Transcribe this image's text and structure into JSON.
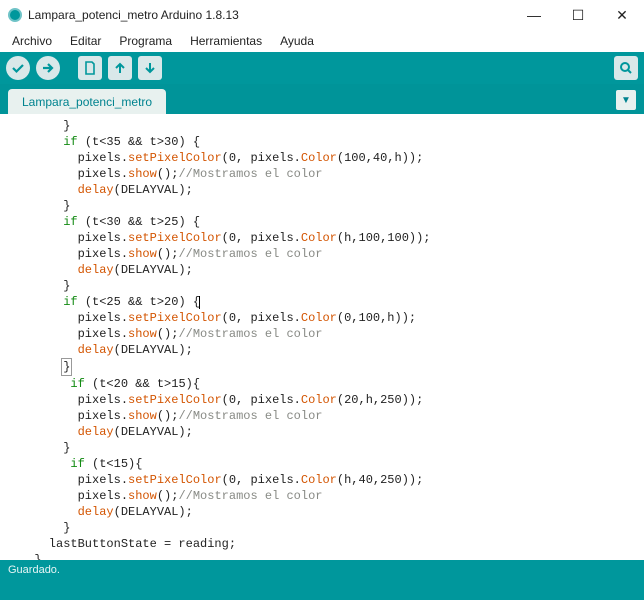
{
  "window": {
    "title": "Lampara_potenci_metro Arduino 1.8.13",
    "min_icon": "—",
    "max_icon": "☐",
    "close_icon": "✕"
  },
  "menu": {
    "archivo": "Archivo",
    "editar": "Editar",
    "programa": "Programa",
    "herramientas": "Herramientas",
    "ayuda": "Ayuda"
  },
  "toolbar_icons": {
    "verify": "verify-icon",
    "upload": "upload-icon",
    "new": "new-icon",
    "open": "open-icon",
    "save": "save-icon",
    "serial": "serial-monitor-icon"
  },
  "tabs": {
    "main": "Lampara_potenci_metro",
    "menu_glyph": "▼"
  },
  "code": {
    "l1": "      }",
    "l2a": "      ",
    "l2b": "if",
    "l2c": " (t<35 && t>30) {",
    "l3a": "        pixels.",
    "l3b": "setPixelColor",
    "l3c": "(0, pixels.",
    "l3d": "Color",
    "l3e": "(100,40,h));",
    "l4a": "        pixels.",
    "l4b": "show",
    "l4c": "();",
    "l4d": "//Mostramos el color",
    "l5a": "        ",
    "l5b": "delay",
    "l5c": "(DELAYVAL);",
    "l6": "      }",
    "l7a": "      ",
    "l7b": "if",
    "l7c": " (t<30 && t>25) {",
    "l8a": "        pixels.",
    "l8b": "setPixelColor",
    "l8c": "(0, pixels.",
    "l8d": "Color",
    "l8e": "(h,100,100));",
    "l9a": "        pixels.",
    "l9b": "show",
    "l9c": "();",
    "l9d": "//Mostramos el color",
    "l10a": "        ",
    "l10b": "delay",
    "l10c": "(DELAYVAL);",
    "l11": "      }",
    "l12a": "      ",
    "l12b": "if",
    "l12c": " (t<25 && t>20) {",
    "l13a": "        pixels.",
    "l13b": "setPixelColor",
    "l13c": "(0, pixels.",
    "l13d": "Color",
    "l13e": "(0,100,h));",
    "l14a": "        pixels.",
    "l14b": "show",
    "l14c": "();",
    "l14d": "//Mostramos el color",
    "l15a": "        ",
    "l15b": "delay",
    "l15c": "(DELAYVAL);",
    "l16": "      ",
    "l16b": "}",
    "l17a": "       ",
    "l17b": "if",
    "l17c": " (t<20 && t>15){",
    "l18a": "        pixels.",
    "l18b": "setPixelColor",
    "l18c": "(0, pixels.",
    "l18d": "Color",
    "l18e": "(20,h,250));",
    "l19a": "        pixels.",
    "l19b": "show",
    "l19c": "();",
    "l19d": "//Mostramos el color",
    "l20a": "        ",
    "l20b": "delay",
    "l20c": "(DELAYVAL);",
    "l21": "      }",
    "l22a": "       ",
    "l22b": "if",
    "l22c": " (t<15){",
    "l23a": "        pixels.",
    "l23b": "setPixelColor",
    "l23c": "(0, pixels.",
    "l23d": "Color",
    "l23e": "(h,40,250));",
    "l24a": "        pixels.",
    "l24b": "show",
    "l24c": "();",
    "l24d": "//Mostramos el color",
    "l25a": "        ",
    "l25b": "delay",
    "l25c": "(DELAYVAL);",
    "l26": "      }",
    "l27": "    lastButtonState = reading;",
    "l28": "  }",
    "l29": "}"
  },
  "status": {
    "message": "Guardado."
  },
  "colors": {
    "teal": "#00979c",
    "keyword": "#128a12",
    "function": "#d35400",
    "comment": "#888a85"
  }
}
